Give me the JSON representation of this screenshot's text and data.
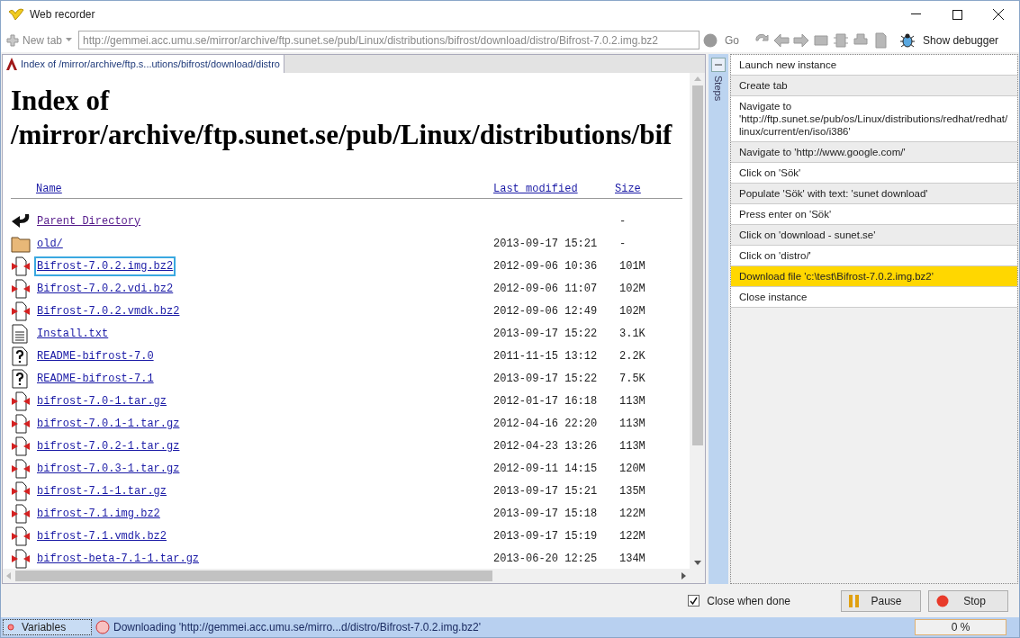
{
  "window": {
    "title": "Web recorder"
  },
  "toolbar": {
    "new_tab": "New tab",
    "address": "http://gemmei.acc.umu.se/mirror/archive/ftp.sunet.se/pub/Linux/distributions/bifrost/download/distro/Bifrost-7.0.2.img.bz2",
    "go": "Go",
    "debugger": "Show debugger"
  },
  "browser_tab": {
    "title": "Index of /mirror/archive/ftp.s...utions/bifrost/download/distro"
  },
  "page": {
    "heading_1": "Index of",
    "heading_2": "/mirror/archive/ftp.sunet.se/pub/Linux/distributions/bif",
    "columns": [
      "Name",
      "Last modified",
      "Size"
    ],
    "rows": [
      {
        "kind": "back",
        "name": "Parent Directory",
        "date": "",
        "size": "-",
        "selected": false
      },
      {
        "kind": "folder",
        "name": "old/",
        "date": "2013-09-17 15:21",
        "size": "-",
        "selected": false
      },
      {
        "kind": "binary",
        "name": "Bifrost-7.0.2.img.bz2",
        "date": "2012-09-06 10:36",
        "size": "101M",
        "selected": true
      },
      {
        "kind": "binary",
        "name": "Bifrost-7.0.2.vdi.bz2",
        "date": "2012-09-06 11:07",
        "size": "102M",
        "selected": false
      },
      {
        "kind": "binary",
        "name": "Bifrost-7.0.2.vmdk.bz2",
        "date": "2012-09-06 12:49",
        "size": "102M",
        "selected": false
      },
      {
        "kind": "text",
        "name": "Install.txt",
        "date": "2013-09-17 15:22",
        "size": "3.1K",
        "selected": false
      },
      {
        "kind": "unknown",
        "name": "README-bifrost-7.0",
        "date": "2011-11-15 13:12",
        "size": "2.2K",
        "selected": false
      },
      {
        "kind": "unknown",
        "name": "README-bifrost-7.1",
        "date": "2013-09-17 15:22",
        "size": "7.5K",
        "selected": false
      },
      {
        "kind": "binary",
        "name": "bifrost-7.0-1.tar.gz",
        "date": "2012-01-17 16:18",
        "size": "113M",
        "selected": false
      },
      {
        "kind": "binary",
        "name": "bifrost-7.0.1-1.tar.gz",
        "date": "2012-04-16 22:20",
        "size": "113M",
        "selected": false
      },
      {
        "kind": "binary",
        "name": "bifrost-7.0.2-1.tar.gz",
        "date": "2012-04-23 13:26",
        "size": "113M",
        "selected": false
      },
      {
        "kind": "binary",
        "name": "bifrost-7.0.3-1.tar.gz",
        "date": "2012-09-11 14:15",
        "size": "120M",
        "selected": false
      },
      {
        "kind": "binary",
        "name": "bifrost-7.1-1.tar.gz",
        "date": "2013-09-17 15:21",
        "size": "135M",
        "selected": false
      },
      {
        "kind": "binary",
        "name": "bifrost-7.1.img.bz2",
        "date": "2013-09-17 15:18",
        "size": "122M",
        "selected": false
      },
      {
        "kind": "binary",
        "name": "bifrost-7.1.vmdk.bz2",
        "date": "2013-09-17 15:19",
        "size": "122M",
        "selected": false
      },
      {
        "kind": "binary",
        "name": "bifrost-beta-7.1-1.tar.gz",
        "date": "2013-06-20 12:25",
        "size": "134M",
        "selected": false
      }
    ]
  },
  "steps": {
    "label": "Steps",
    "items": [
      {
        "text": "Launch new instance",
        "selected": false
      },
      {
        "text": "Create tab",
        "selected": false
      },
      {
        "text": "Navigate to 'http://ftp.sunet.se/pub/os/Linux/distributions/redhat/redhat/linux/current/en/iso/i386'",
        "selected": false
      },
      {
        "text": "Navigate to 'http://www.google.com/'",
        "selected": false
      },
      {
        "text": "Click on 'Sök'",
        "selected": false
      },
      {
        "text": "Populate 'Sök' with text: 'sunet download'",
        "selected": false
      },
      {
        "text": "Press enter on 'Sök'",
        "selected": false
      },
      {
        "text": "Click on 'download - sunet.se'",
        "selected": false
      },
      {
        "text": "Click on 'distro/'",
        "selected": false
      },
      {
        "text": "Download file 'c:\\test\\Bifrost-7.0.2.img.bz2'",
        "selected": true
      },
      {
        "text": "Close instance",
        "selected": false
      }
    ]
  },
  "controls": {
    "close_when_done": {
      "label": "Close when done",
      "checked": true
    },
    "pause": "Pause",
    "stop": "Stop"
  },
  "status_bar": {
    "variables": "Variables",
    "message": "Downloading 'http://gemmei.acc.umu.se/mirro...d/distro/Bifrost-7.0.2.img.bz2'",
    "progress": "0 %"
  }
}
